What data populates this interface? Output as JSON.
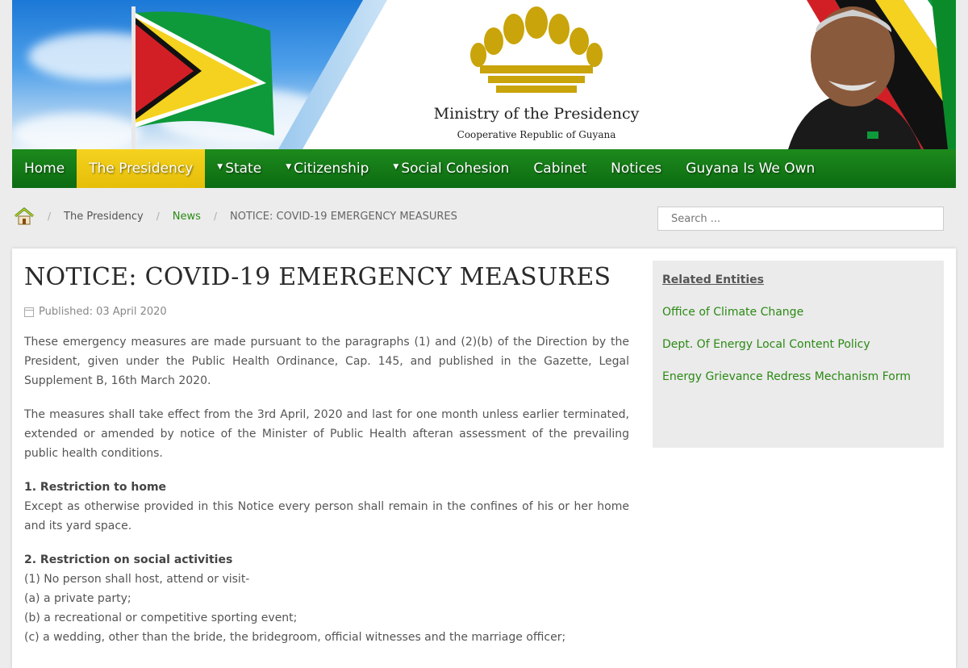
{
  "header": {
    "title": "Ministry of the Presidency",
    "subtitle": "Cooperative Republic of Guyana"
  },
  "nav": {
    "items": [
      {
        "label": "Home",
        "dropdown": false,
        "active": false
      },
      {
        "label": "The Presidency",
        "dropdown": false,
        "active": true
      },
      {
        "label": "State",
        "dropdown": true,
        "active": false
      },
      {
        "label": "Citizenship",
        "dropdown": true,
        "active": false
      },
      {
        "label": "Social Cohesion",
        "dropdown": true,
        "active": false
      },
      {
        "label": "Cabinet",
        "dropdown": false,
        "active": false
      },
      {
        "label": "Notices",
        "dropdown": false,
        "active": false
      },
      {
        "label": "Guyana Is We Own",
        "dropdown": false,
        "active": false
      }
    ]
  },
  "breadcrumb": {
    "home_icon": "home-icon",
    "items": [
      "The Presidency",
      "News",
      "NOTICE: COVID-19 EMERGENCY MEASURES"
    ]
  },
  "search": {
    "placeholder": "Search ..."
  },
  "article": {
    "title": "NOTICE: COVID-19 EMERGENCY MEASURES",
    "published": "Published: 03 April 2020",
    "paragraphs": [
      "These emergency measures are made pursuant to the paragraphs (1) and (2)(b) of the Direction by the President, given under the Public Health Ordinance, Cap. 145, and published in the Gazette, Legal Supplement B, 16th March 2020.",
      "The measures shall take effect from the 3rd April, 2020 and last for one month unless earlier terminated, extended or amended by notice of the Minister of Public Health afteran assessment of the prevailing public health conditions."
    ],
    "section1": {
      "heading": "1. Restriction to home",
      "text": "Except as otherwise provided in this Notice every person shall remain in the confines of his or her home and its yard space."
    },
    "section2": {
      "heading": "2. Restriction on social activities",
      "lines": [
        "(1) No person shall host, attend or visit-",
        "(a) a private party;",
        "(b) a recreational or competitive sporting event;",
        "(c) a wedding, other than the bride, the bridegroom, official witnesses and the marriage officer;"
      ]
    }
  },
  "sidebar": {
    "title": "Related Entities",
    "items": [
      "Office of Climate Change",
      "Dept. Of Energy Local Content Policy",
      "Energy Grievance Redress Mechanism Form"
    ]
  },
  "colors": {
    "nav_green": "#0c6b11",
    "nav_active_yellow": "#e6be08",
    "link_green": "#2b8a14"
  }
}
